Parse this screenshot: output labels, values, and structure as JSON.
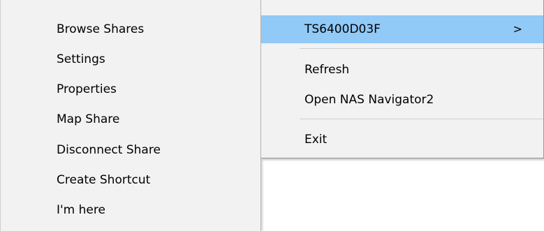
{
  "submenu": {
    "items": [
      {
        "label": "Browse Shares"
      },
      {
        "label": "Settings"
      },
      {
        "label": "Properties"
      },
      {
        "label": "Map Share"
      },
      {
        "label": "Disconnect Share"
      },
      {
        "label": "Create Shortcut"
      },
      {
        "label": "I'm here"
      }
    ]
  },
  "mainmenu": {
    "device": {
      "label": "TS6400D03F",
      "arrow": ">",
      "arrow_icon": "chevron-right-icon"
    },
    "refresh": {
      "label": "Refresh"
    },
    "open_nas": {
      "label": "Open NAS Navigator2"
    },
    "exit": {
      "label": "Exit"
    }
  },
  "colors": {
    "menu_background": "#f2f2f2",
    "highlight": "#91c9f7",
    "separator": "#d0d0d0"
  }
}
